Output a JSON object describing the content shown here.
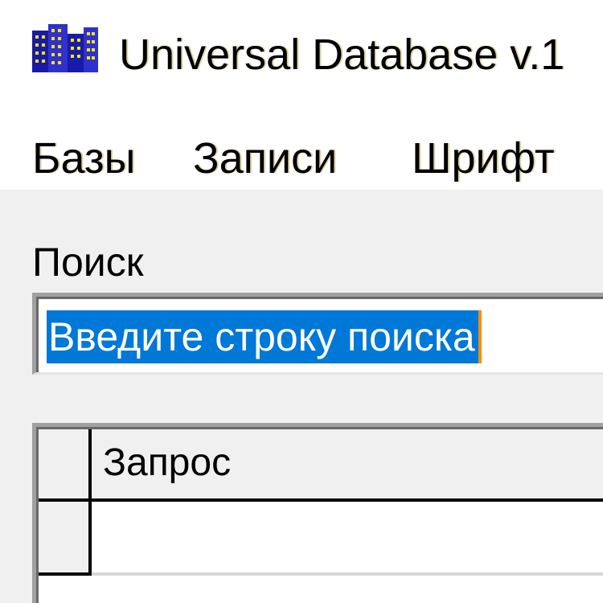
{
  "window": {
    "title": "Universal Database v.1",
    "icon": "app-database-icon"
  },
  "menu": {
    "items": [
      "Базы",
      "Записи",
      "Шрифт"
    ]
  },
  "search": {
    "label": "Поиск",
    "value": "Введите строку поиска",
    "selected": true
  },
  "grid": {
    "columns": [
      "Запрос"
    ],
    "rows": [
      [
        ""
      ]
    ]
  },
  "colors": {
    "selection": "#0078d7",
    "caret": "#ff8c00",
    "window_background": "#f0f0f0",
    "field_background": "#ffffff"
  }
}
